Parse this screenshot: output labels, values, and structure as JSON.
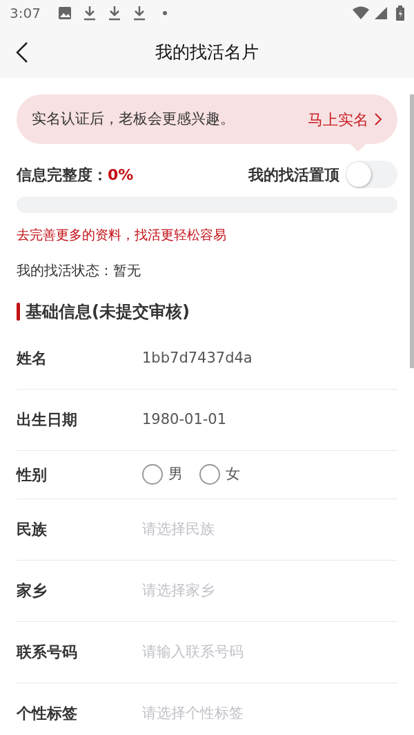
{
  "status_bar": {
    "time": "3:07"
  },
  "header": {
    "title": "我的找活名片"
  },
  "banner": {
    "message": "实名认证后，老板会更感兴趣。",
    "action": "马上实名"
  },
  "completeness": {
    "label": "信息完整度：",
    "value": "0%",
    "level": 0
  },
  "pin_top": {
    "label": "我的找活置顶",
    "on": false
  },
  "tip": "去完善更多的资料，找活更轻松容易",
  "job_status": "我的找活状态：暂无",
  "section": {
    "title": "基础信息(未提交审核)"
  },
  "fields": [
    {
      "kind": "text",
      "label": "姓名",
      "value": "1bb7d7437d4a"
    },
    {
      "kind": "text",
      "label": "出生日期",
      "value": "1980-01-01"
    },
    {
      "kind": "radio",
      "label": "性别",
      "options": [
        {
          "label": "男",
          "selected": false
        },
        {
          "label": "女",
          "selected": false
        }
      ]
    },
    {
      "kind": "select",
      "label": "民族",
      "placeholder": "请选择民族"
    },
    {
      "kind": "select",
      "label": "家乡",
      "placeholder": "请选择家乡"
    },
    {
      "kind": "input",
      "label": "联系号码",
      "placeholder": "请输入联系号码"
    },
    {
      "kind": "select",
      "label": "个性标签",
      "placeholder": "请选择个性标签"
    }
  ]
}
